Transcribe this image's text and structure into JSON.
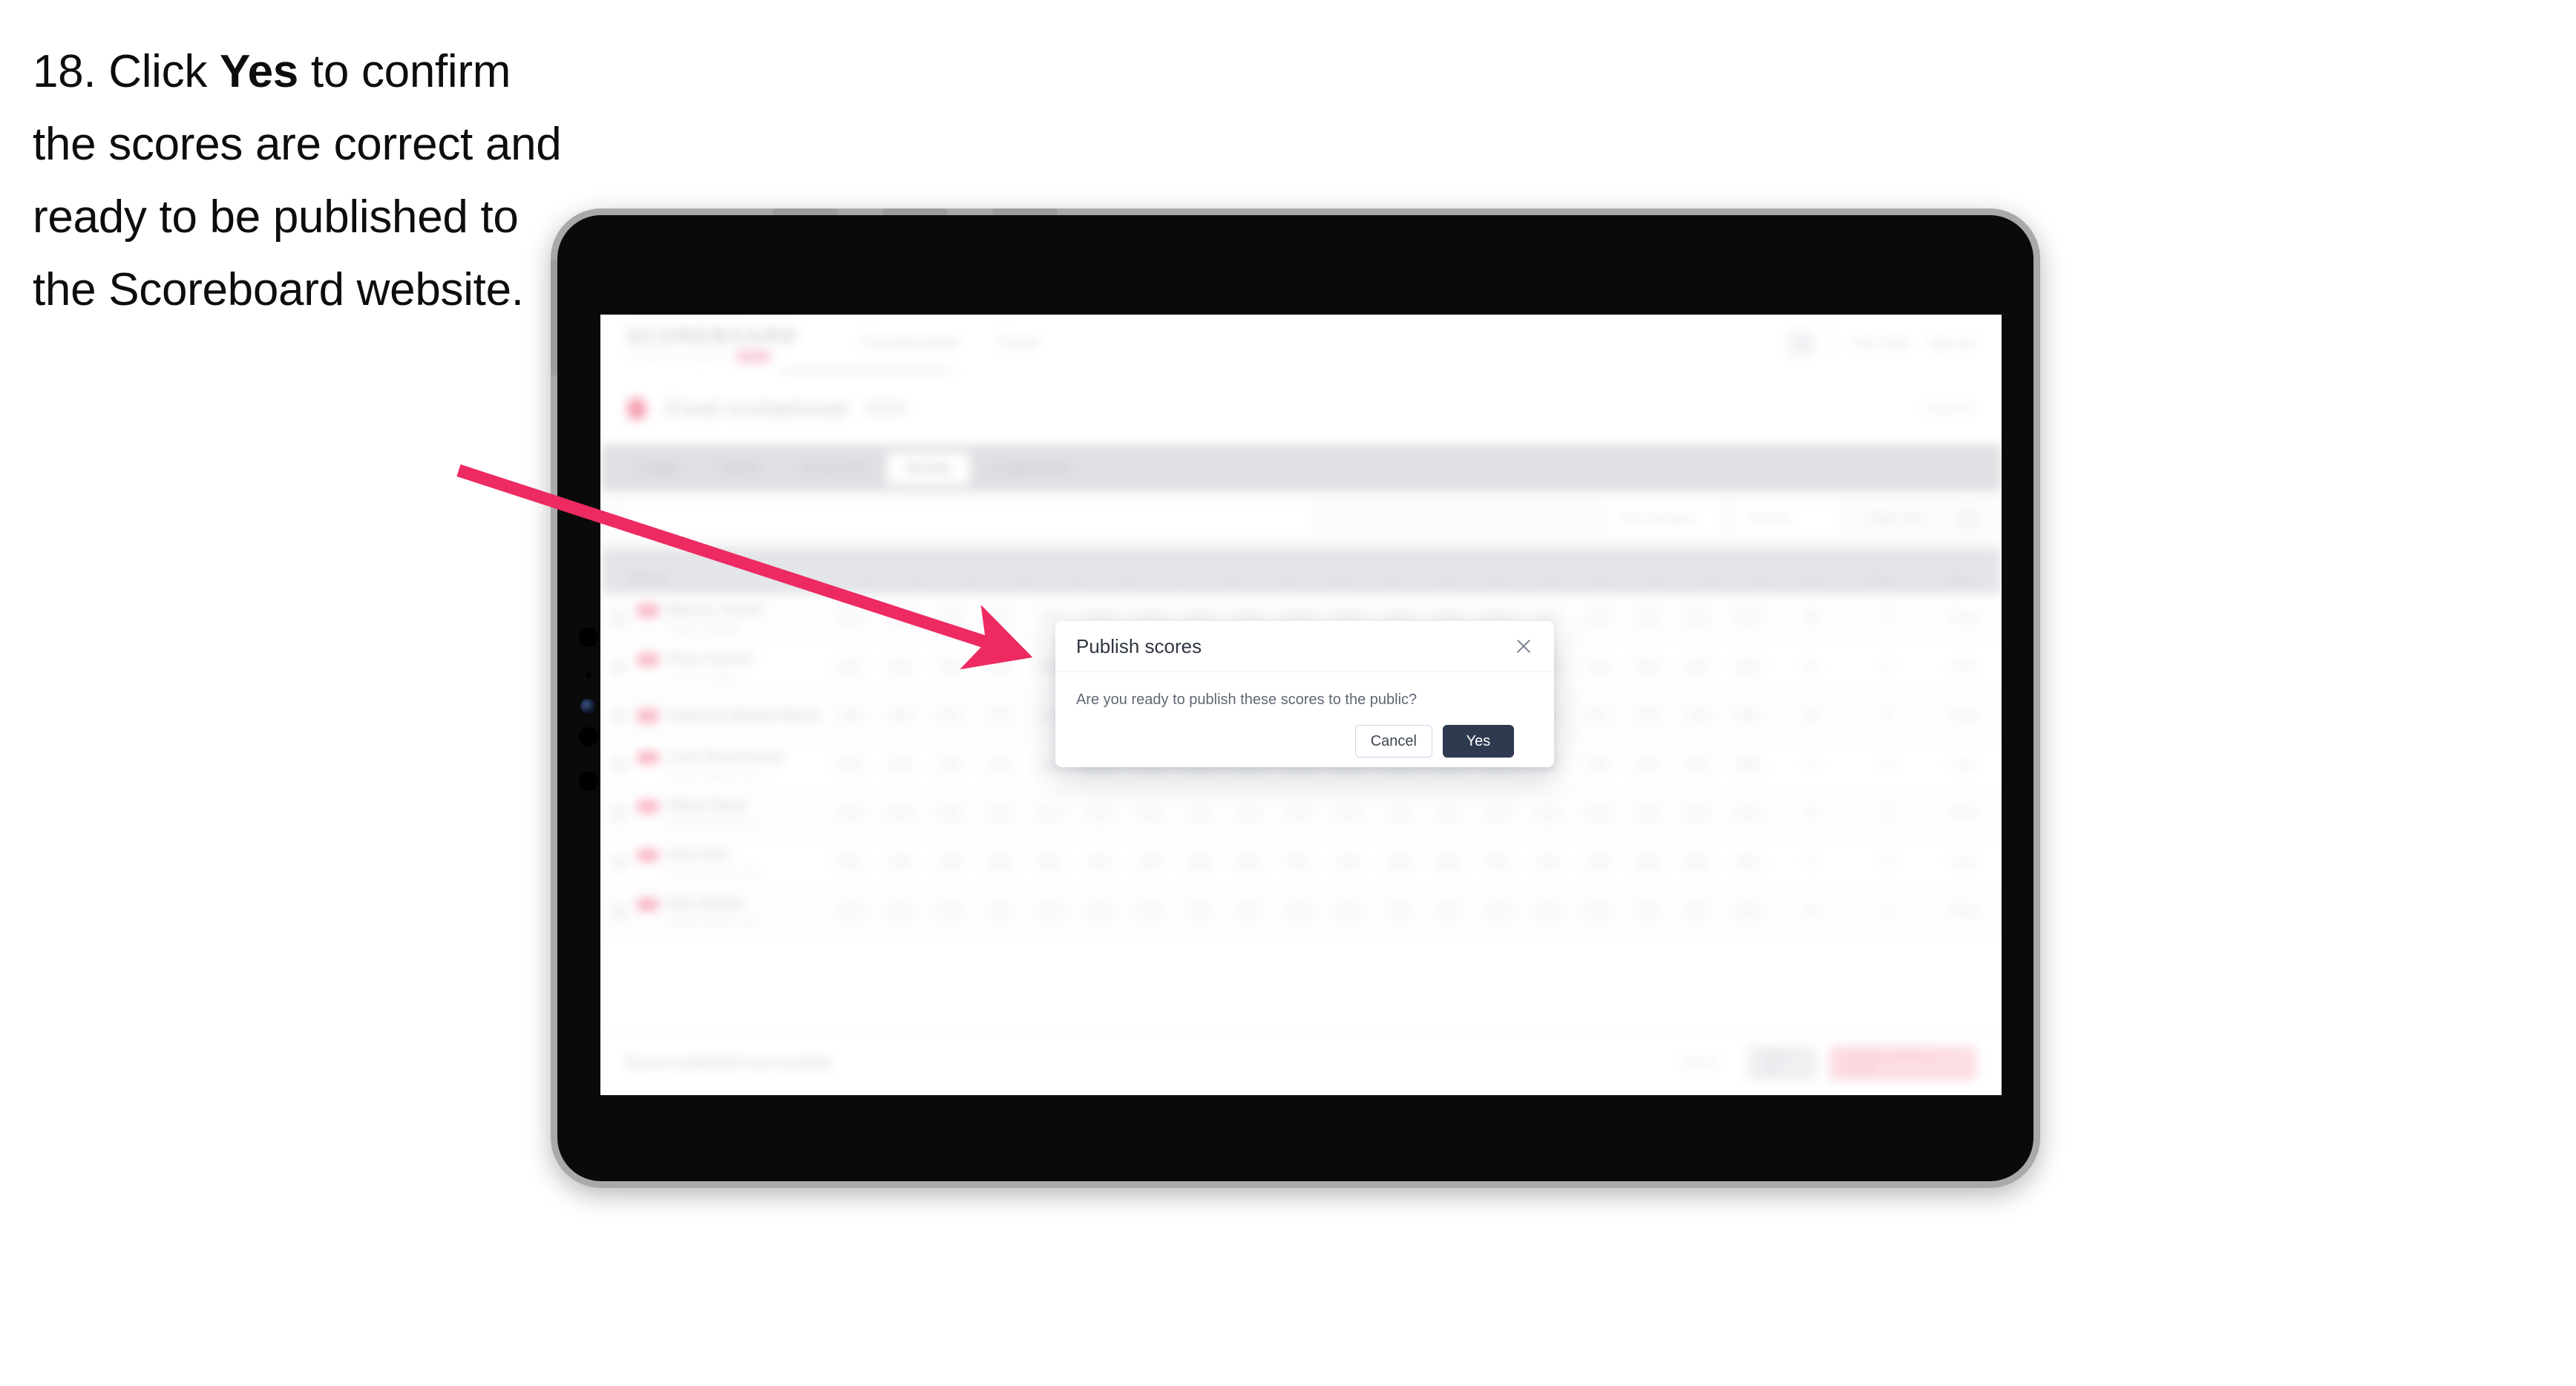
{
  "instruction": {
    "number": "18.",
    "text_before": "Click ",
    "emphasis": "Yes",
    "text_after": " to confirm the scores are correct and ready to be published to the Scoreboard website."
  },
  "annotation": {
    "arrow_color": "#ED2A62",
    "points_to": "modal-dialog"
  },
  "device": {
    "type": "tablet",
    "orientation": "landscape",
    "bezel_color": "#a9a9ab",
    "body_color": "#0a0a0a"
  },
  "app": {
    "brand": {
      "wordmark": "SCOREBOARD",
      "subtitle": "Competition Management",
      "pill": "BETA"
    },
    "header_nav": [
      "Championships",
      "Teams"
    ],
    "header_right": [
      "Tom Clark",
      "Sign out"
    ],
    "event": {
      "title": "Final Invitational",
      "tag": "2024",
      "right_label": "Event ID"
    },
    "tabs": [
      {
        "label": "Details",
        "active": false
      },
      {
        "label": "Teams",
        "active": false
      },
      {
        "label": "Score Grid",
        "active": false
      },
      {
        "label": "Results",
        "active": true
      },
      {
        "label": "Leaderboard",
        "active": false
      }
    ],
    "filters": {
      "search_placeholder": "Search",
      "controls": [
        "Pool Standard",
        "Division",
        "Table Only"
      ]
    },
    "table": {
      "columns": [
        "Player",
        "1",
        "2",
        "3",
        "4",
        "5",
        "6",
        "7",
        "8",
        "9",
        "10",
        "11",
        "12",
        "13",
        "14",
        "15",
        "16",
        "17",
        "18",
        "Par",
        "Total",
        "Status"
      ],
      "rows": [
        {
          "name": "Marcus Turner",
          "sub": "Eastern Collegiate",
          "par": "68",
          "total": "70",
          "status": "Final"
        },
        {
          "name": "Rhys Parnell",
          "sub": "Eastern Collegiate",
          "par": "69",
          "total": "71",
          "status": "Final"
        },
        {
          "name": "Cameron Barker-Davis",
          "sub": "",
          "par": "69",
          "total": "71",
          "status": "Final"
        },
        {
          "name": "Liam Beauchamp",
          "sub": "Northern Regional Club",
          "par": "70",
          "total": "72",
          "status": "Final"
        },
        {
          "name": "Oliver Reed",
          "sub": "Northern Regional Club",
          "par": "71",
          "total": "73",
          "status": "Final"
        },
        {
          "name": "Sam Ellis",
          "sub": "Northern Regional Club",
          "par": "71",
          "total": "73",
          "status": "Final"
        },
        {
          "name": "Alex Barker",
          "sub": "Southern Athletic Union",
          "par": "72",
          "total": "74",
          "status": "Final"
        }
      ]
    },
    "footer": {
      "note": "Scores published successfully",
      "link_label": "Cancel",
      "secondary_label": "Save All",
      "primary_label": "Publish scores to public"
    }
  },
  "modal": {
    "title": "Publish scores",
    "body": "Are you ready to publish these scores to the public?",
    "cancel_label": "Cancel",
    "confirm_label": "Yes",
    "close_icon": "close-icon",
    "confirm_color": "#2d3a50"
  }
}
